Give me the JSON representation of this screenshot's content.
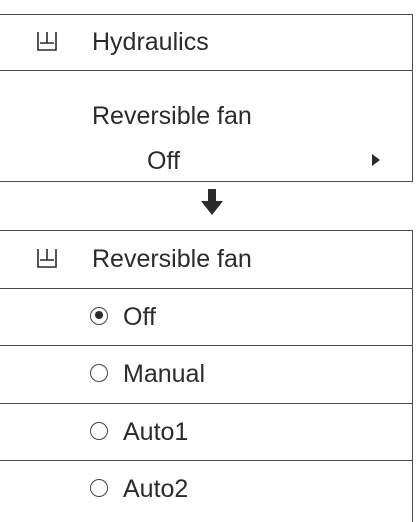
{
  "top_panel": {
    "header": {
      "icon": "hydraulics-icon",
      "label": "Hydraulics"
    },
    "setting": {
      "label": "Reversible fan",
      "value": "Off",
      "arrow_icon": "triangle-right-icon"
    }
  },
  "transition_icon": "arrow-down-icon",
  "bottom_panel": {
    "header": {
      "icon": "hydraulics-icon",
      "label": "Reversible fan"
    },
    "options": [
      {
        "label": "Off",
        "selected": true
      },
      {
        "label": "Manual",
        "selected": false
      },
      {
        "label": "Auto1",
        "selected": false
      },
      {
        "label": "Auto2",
        "selected": false
      }
    ]
  },
  "colors": {
    "text": "#2b2b2b",
    "border": "#4a4a4a",
    "background": "#ffffff"
  }
}
